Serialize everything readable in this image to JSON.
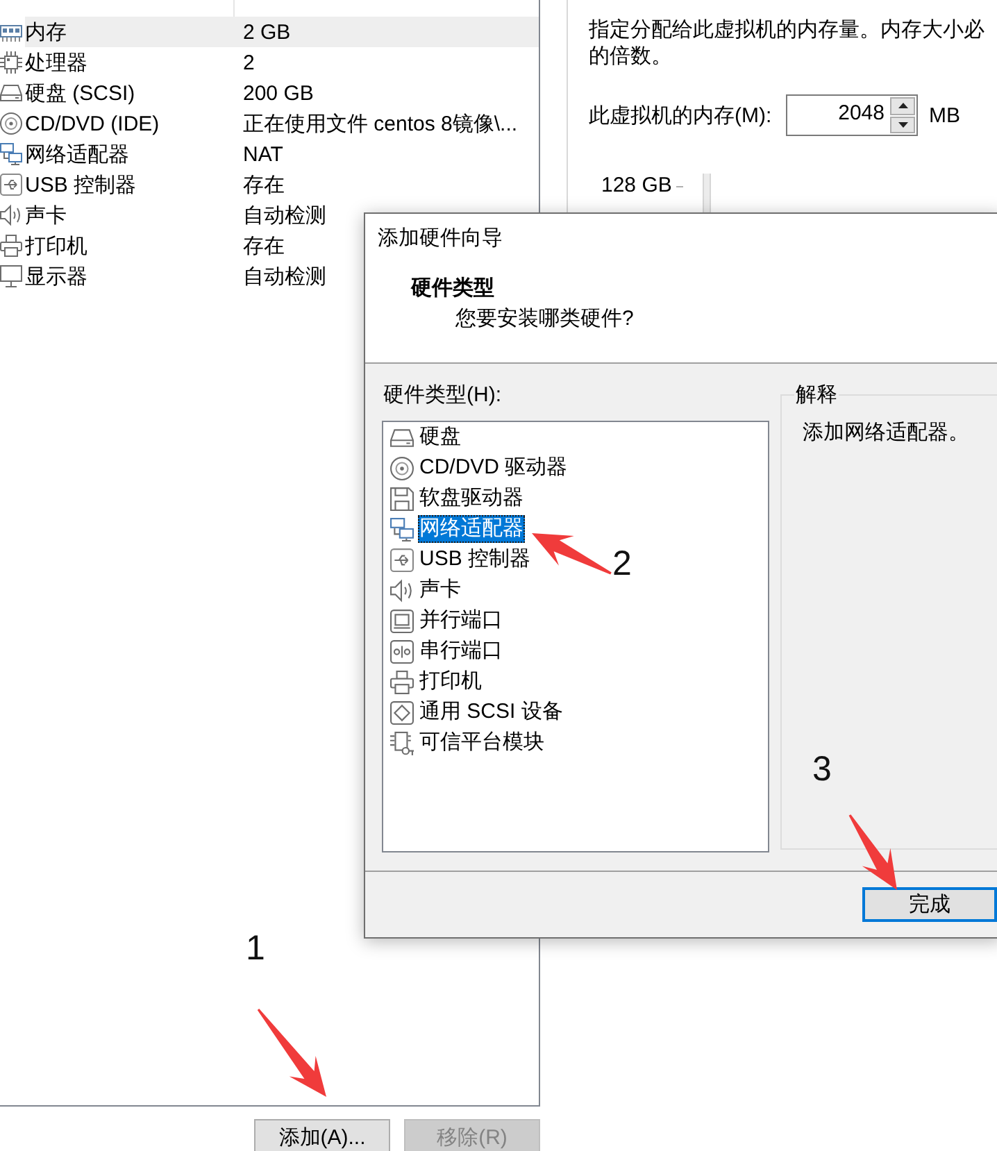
{
  "device_table": {
    "rows": [
      {
        "kind": "memory",
        "device": "内存",
        "summary": "2 GB",
        "selected": true
      },
      {
        "kind": "processor",
        "device": "处理器",
        "summary": "2",
        "selected": false
      },
      {
        "kind": "disk",
        "device": "硬盘 (SCSI)",
        "summary": "200 GB",
        "selected": false
      },
      {
        "kind": "cdrom",
        "device": "CD/DVD (IDE)",
        "summary": "正在使用文件 centos 8镜像\\...",
        "selected": false
      },
      {
        "kind": "network",
        "device": "网络适配器",
        "summary": "NAT",
        "selected": false
      },
      {
        "kind": "usb",
        "device": "USB 控制器",
        "summary": "存在",
        "selected": false
      },
      {
        "kind": "sound",
        "device": "声卡",
        "summary": "自动检测",
        "selected": false
      },
      {
        "kind": "printer",
        "device": "打印机",
        "summary": "存在",
        "selected": false
      },
      {
        "kind": "display",
        "device": "显示器",
        "summary": "自动检测",
        "selected": false
      }
    ]
  },
  "device_buttons": [
    {
      "label": "添加(A)...",
      "disabled": false
    },
    {
      "label": "移除(R)",
      "disabled": true
    }
  ],
  "memory_panel": {
    "description": [
      "指定分配给此虚拟机的内存量。内存大小必",
      "的倍数。"
    ],
    "size_label": "此虚拟机的内存(M):",
    "size_value": "2048",
    "size_unit": "MB",
    "slider_max_label": "128 GB"
  },
  "dialog": {
    "title": "添加硬件向导",
    "heading": "硬件类型",
    "subheading": "您要安装哪类硬件?",
    "list_label": "硬件类型(H):",
    "hardware_types": [
      {
        "kind": "disk",
        "label": "硬盘",
        "selected": false
      },
      {
        "kind": "cdrom",
        "label": "CD/DVD 驱动器",
        "selected": false
      },
      {
        "kind": "floppy",
        "label": "软盘驱动器",
        "selected": false
      },
      {
        "kind": "network",
        "label": "网络适配器",
        "selected": true
      },
      {
        "kind": "usb",
        "label": "USB 控制器",
        "selected": false
      },
      {
        "kind": "sound",
        "label": "声卡",
        "selected": false
      },
      {
        "kind": "parallel",
        "label": "并行端口",
        "selected": false
      },
      {
        "kind": "serial",
        "label": "串行端口",
        "selected": false
      },
      {
        "kind": "printer",
        "label": "打印机",
        "selected": false
      },
      {
        "kind": "scsi",
        "label": "通用 SCSI 设备",
        "selected": false
      },
      {
        "kind": "tpm",
        "label": "可信平台模块",
        "selected": false
      }
    ],
    "explanation": {
      "legend": "解释",
      "text": "添加网络适配器。"
    },
    "buttons": [
      {
        "label": "完成",
        "focused": true
      }
    ]
  },
  "annotations": [
    {
      "text": "1"
    },
    {
      "text": "2"
    },
    {
      "text": "3"
    }
  ]
}
